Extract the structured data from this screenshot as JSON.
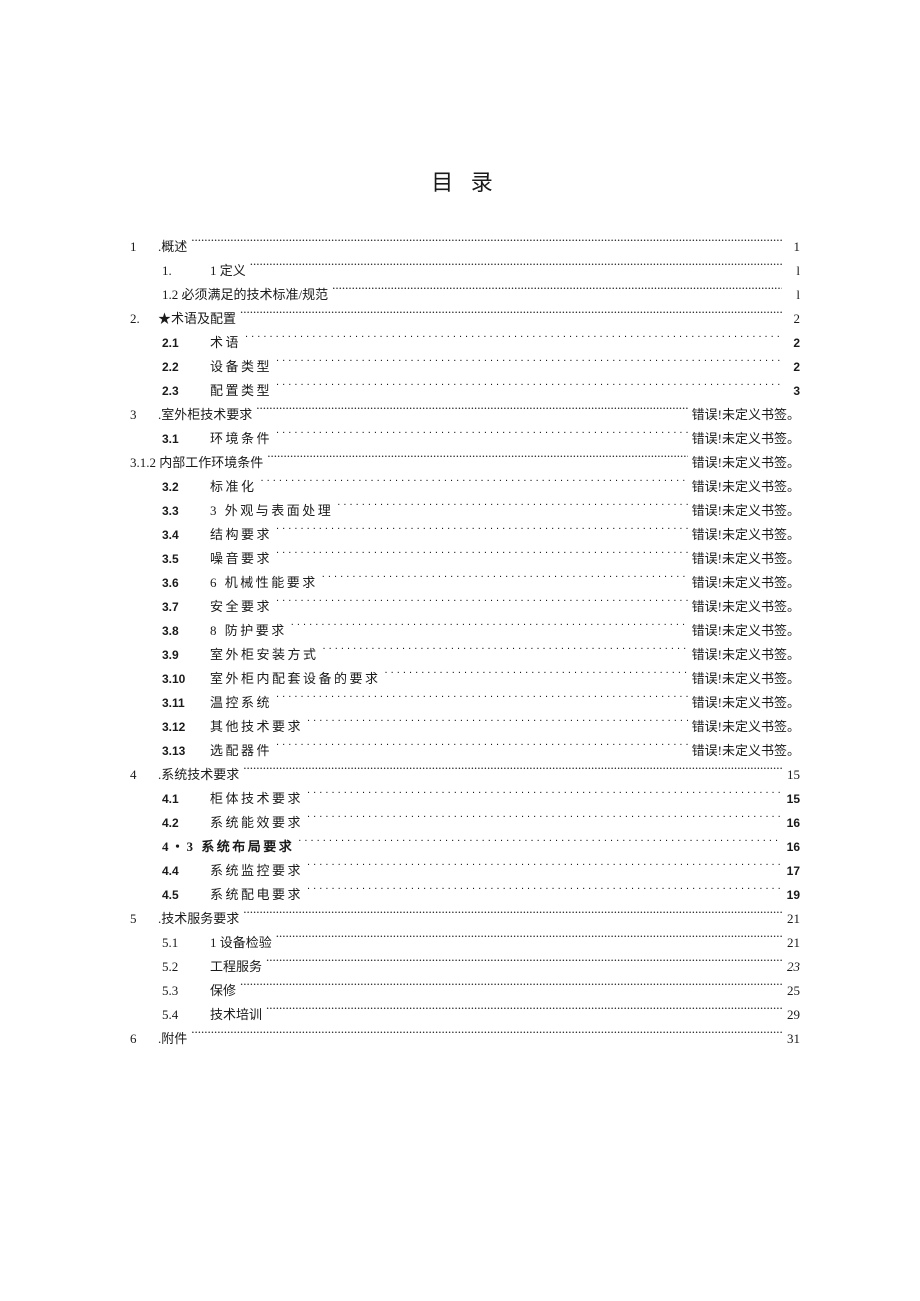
{
  "title": "目 录",
  "error_text": "错误!未定义书签。",
  "entries": [
    {
      "indent": 0,
      "num": "1",
      "label": ".概述",
      "leader": "tight",
      "page": "1",
      "num_style": "plain",
      "label_style": "",
      "page_style": ""
    },
    {
      "indent": 1,
      "num": "1.",
      "label": "1 定义",
      "leader": "tight",
      "page": "l",
      "num_style": "plain",
      "label_style": "",
      "page_style": ""
    },
    {
      "indent": 1,
      "num": "",
      "label": "1.2 必须满足的技术标准/规范",
      "leader": "tight",
      "page": "l",
      "num_style": "plain",
      "label_style": "",
      "page_style": ""
    },
    {
      "indent": 0,
      "num": "2.",
      "label": "★术语及配置",
      "leader": "tight",
      "page": "2",
      "num_style": "plain",
      "label_style": "",
      "page_style": ""
    },
    {
      "indent": 1,
      "num": "2.1",
      "label": "术语",
      "leader": "dots",
      "page": "2",
      "num_style": "bold",
      "label_style": "letterspace",
      "page_style": "bold"
    },
    {
      "indent": 1,
      "num": "2.2",
      "label": "设备类型",
      "leader": "dots",
      "page": "2",
      "num_style": "bold",
      "label_style": "letterspace",
      "page_style": "bold"
    },
    {
      "indent": 1,
      "num": "2.3",
      "label": "配置类型",
      "leader": "dots",
      "page": "3",
      "num_style": "bold",
      "label_style": "letterspace",
      "page_style": "bold"
    },
    {
      "indent": 0,
      "num": "3",
      "label": ".室外柜技术要求",
      "leader": "tight",
      "page": "错误!未定义书签。",
      "num_style": "plain",
      "label_style": "",
      "page_style": ""
    },
    {
      "indent": 1,
      "num": "3.1",
      "label": "环境条件",
      "leader": "dots",
      "page": "错误!未定义书签。",
      "num_style": "bold",
      "label_style": "letterspace",
      "page_style": ""
    },
    {
      "indent": 0,
      "num": "",
      "label": "3.1.2 内部工作环境条件",
      "leader": "tight",
      "page": "错误!未定义书签。",
      "num_style": "plain",
      "label_style": "",
      "page_style": ""
    },
    {
      "indent": 1,
      "num": "3.2",
      "label": "标准化",
      "leader": "dots",
      "page": "错误!未定义书签。",
      "num_style": "bold",
      "label_style": "letterspace",
      "page_style": ""
    },
    {
      "indent": 1,
      "num": "3.3",
      "label": "3 外观与表面处理",
      "leader": "dots",
      "page": "错误!未定义书签。",
      "num_style": "bold",
      "label_style": "letterspace",
      "page_style": ""
    },
    {
      "indent": 1,
      "num": "3.4",
      "label": "结构要求",
      "leader": "dots",
      "page": "错误!未定义书签。",
      "num_style": "bold",
      "label_style": "letterspace",
      "page_style": ""
    },
    {
      "indent": 1,
      "num": "3.5",
      "label": "噪音要求",
      "leader": "dots",
      "page": "错误!未定义书签。",
      "num_style": "bold",
      "label_style": "letterspace",
      "page_style": ""
    },
    {
      "indent": 1,
      "num": "3.6",
      "label": "6 机械性能要求",
      "leader": "dots",
      "page": "错误!未定义书签。",
      "num_style": "bold",
      "label_style": "letterspace",
      "page_style": ""
    },
    {
      "indent": 1,
      "num": "3.7",
      "label": "安全要求",
      "leader": "dots",
      "page": "错误!未定义书签。",
      "num_style": "bold",
      "label_style": "letterspace",
      "page_style": ""
    },
    {
      "indent": 1,
      "num": "3.8",
      "label": "8 防护要求",
      "leader": "dots",
      "page": "错误!未定义书签。",
      "num_style": "bold",
      "label_style": "letterspace",
      "page_style": ""
    },
    {
      "indent": 1,
      "num": "3.9",
      "label": "室外柜安装方式",
      "leader": "dots",
      "page": "错误!未定义书签。",
      "num_style": "bold",
      "label_style": "letterspace",
      "page_style": ""
    },
    {
      "indent": 1,
      "num": "3.10",
      "label": "室外柜内配套设备的要求",
      "leader": "dots",
      "page": "错误!未定义书签。",
      "num_style": "bold",
      "label_style": "letterspace",
      "page_style": ""
    },
    {
      "indent": 1,
      "num": "3.11",
      "label": "温控系统",
      "leader": "dots",
      "page": "错误!未定义书签。",
      "num_style": "bold",
      "label_style": "letterspace",
      "page_style": ""
    },
    {
      "indent": 1,
      "num": "3.12",
      "label": "其他技术要求",
      "leader": "dots",
      "page": "错误!未定义书签。",
      "num_style": "bold",
      "label_style": "letterspace",
      "page_style": ""
    },
    {
      "indent": 1,
      "num": "3.13",
      "label": "选配器件",
      "leader": "dots",
      "page": "错误!未定义书签。",
      "num_style": "bold",
      "label_style": "letterspace",
      "page_style": ""
    },
    {
      "indent": 0,
      "num": "4",
      "label": ".系统技术要求",
      "leader": "tight",
      "page": "15",
      "num_style": "plain",
      "label_style": "",
      "page_style": ""
    },
    {
      "indent": 1,
      "num": "4.1",
      "label": "柜体技术要求",
      "leader": "dots",
      "page": "15",
      "num_style": "bold",
      "label_style": "letterspace",
      "page_style": "bold"
    },
    {
      "indent": 1,
      "num": "4.2",
      "label": "系统能效要求",
      "leader": "dots",
      "page": "16",
      "num_style": "bold",
      "label_style": "letterspace",
      "page_style": "bold"
    },
    {
      "indent": 1,
      "num": "",
      "label": "4・3 系统布局要求",
      "leader": "dots",
      "page": "16",
      "num_style": "bold",
      "label_style": "bold letterspace",
      "page_style": "bold"
    },
    {
      "indent": 1,
      "num": "4.4",
      "label": "系统监控要求",
      "leader": "dots",
      "page": "17",
      "num_style": "bold",
      "label_style": "letterspace",
      "page_style": "bold"
    },
    {
      "indent": 1,
      "num": "4.5",
      "label": "系统配电要求",
      "leader": "dots",
      "page": "19",
      "num_style": "bold",
      "label_style": "letterspace",
      "page_style": "bold"
    },
    {
      "indent": 0,
      "num": "5",
      "label": ".技术服务要求",
      "leader": "tight",
      "page": "21",
      "num_style": "plain",
      "label_style": "",
      "page_style": ""
    },
    {
      "indent": 1,
      "num": "5.1",
      "label": "1 设备检验",
      "leader": "tight",
      "page": "21",
      "num_style": "plain",
      "label_style": "",
      "page_style": ""
    },
    {
      "indent": 1,
      "num": "5.2",
      "label": "工程服务",
      "leader": "tight",
      "page": "23",
      "num_style": "plain",
      "label_style": "",
      "page_style": "italic"
    },
    {
      "indent": 1,
      "num": "5.3",
      "label": "保修",
      "leader": "tight",
      "page": "25",
      "num_style": "plain",
      "label_style": "",
      "page_style": ""
    },
    {
      "indent": 1,
      "num": "5.4",
      "label": "技术培训",
      "leader": "tight",
      "page": "29",
      "num_style": "plain",
      "label_style": "",
      "page_style": ""
    },
    {
      "indent": 0,
      "num": "6",
      "label": ".附件",
      "leader": "tight",
      "page": "31",
      "num_style": "plain",
      "label_style": "",
      "page_style": ""
    }
  ]
}
